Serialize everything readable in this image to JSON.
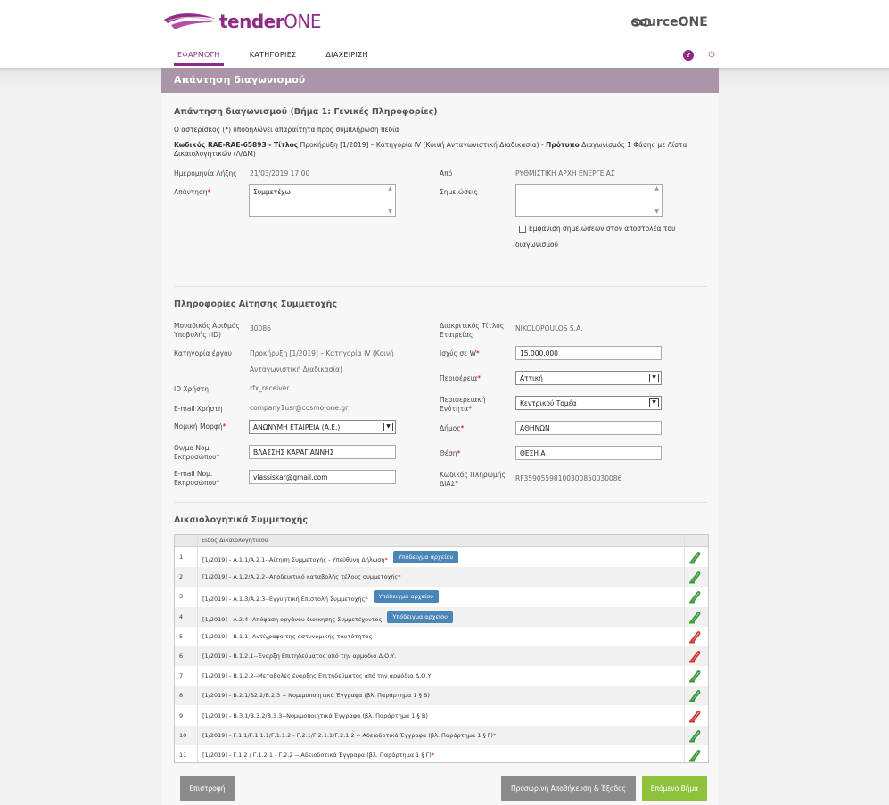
{
  "app": {
    "logo_bold": "tender",
    "logo_light": "ONE",
    "partner_logo": "sourceONE"
  },
  "nav": {
    "items": [
      "ΕΦΑΡΜΟΓΗ",
      "ΚΑΤΗΓΟΡΙΕΣ",
      "ΔΙΑΧΕΙΡΙΣΗ"
    ],
    "help_icon": "?",
    "power_icon": "⏻"
  },
  "page_title": "Απάντηση διαγωνισμού",
  "step1": {
    "title": "Απάντηση διαγωνισμού (Βήμα 1: Γενικές Πληροφορίες)",
    "required_note": "Ο αστερίσκος (*) υποδηλώνει απαραίτητα προς συμπλήρωση πεδία",
    "code_label": "Κωδικός RAE-RAE-65893 - ",
    "title_label": "Τίτλος",
    "title_value": " Προκήρυξη [1/2019] – Κατηγορία IV (Κοινή Ανταγωνιστική Διαδικασία) - ",
    "template_label": "Πρότυπο",
    "template_value_line1": " Διαγωνισμός 1 Φάσης με Λίστα",
    "template_value_line2": "Δικαιολογητικών (Λ/ΔΜ)",
    "deadline_label": "Ημερομηνία Λήξης",
    "deadline_value": "21/03/2019 17:00",
    "from_label": "Από",
    "from_value": "ΡΥΘΜΙΣΤΙΚΗ ΑΡΧΗ ΕΝΕΡΓΕΙΑΣ",
    "answer_label": "Απάντηση",
    "answer_value": "Συμμετέχω",
    "notes_label": "Σημειώσεις",
    "notes_value": "",
    "show_notes_line1": "Εμφάνιση σημειώσεων στον αποστολέα του",
    "show_notes_line2": "διαγωνισμού"
  },
  "application": {
    "title": "Πληροφορίες Αίτησης Συμμετοχής",
    "id_label": "Μοναδικός Αριθμός Υποβολής (ID)",
    "id_value": "30086",
    "category_label": "Κατηγορία έργου",
    "category_line1": "Προκήρυξη [1/2019] – Κατηγορία IV (Κοινή",
    "category_line2": "Ανταγωνιστική Διαδικασία)",
    "user_id_label": "ID Χρήστη",
    "user_id_value": "rfx_receiver",
    "email_label": "E-mail Χρήστη",
    "email_value": "company1usr@cosmo-one.gr",
    "legal_form_label": "Νομική Μορφή",
    "legal_form_value": "ΑΝΩΝΥΜΗ ΕΤΑΙΡΕΙΑ (Α.Ε.)",
    "rep_name_label": "Ον/μο Νομ. Εκπροσώπου",
    "rep_name_value": "ΒΛΑΣΣΗΣ ΚΑΡΑΓΙΑΝΝΗΣ",
    "rep_email_label": "E-mail Νομ. Εκπροσώπου",
    "rep_email_value": "vlassiskar@gmail.com",
    "trade_name_label": "Διακριτικός Τίτλος Εταιρείας",
    "trade_name_value": "NIKOLOPOULOS S.A.",
    "power_label": "Ισχύς σε W",
    "power_value": "15.000.000",
    "region_label": "Περιφέρεια",
    "region_value": "Αττική",
    "unit_label": "Περιφερειακή Ενότητα",
    "unit_value": "Κεντρικού Τομέα",
    "municipality_label": "Δήμος",
    "municipality_value": "ΑΘΗΝΩΝ",
    "position_label": "Θέση",
    "position_value": "ΘΕΣΗ Α",
    "payment_code_label": "Κωδικός Πληρωμής ΔΙΑΣ",
    "payment_code_value": "RF35905598100300850030086"
  },
  "documents": {
    "title": "Δικαιολογητικά Συμμετοχής",
    "column_header": "Είδος Δικαιολογητικού",
    "sample_label": "Υπόδειγμα αρχείου",
    "rows": [
      {
        "num": "1",
        "text": "[1/2019] - Α.1.1/Α.2.1--Αίτηση Συμμετοχής - Υπεύθυνη Δήλωση",
        "req": "*",
        "sample": true,
        "clip": "green"
      },
      {
        "num": "2",
        "text": "[1/2019] - Α.1.2/Α.2.2--Αποδεικτικό καταβολής τέλους συμμετοχής",
        "req": "*",
        "sample": false,
        "clip": "green"
      },
      {
        "num": "3",
        "text": "[1/2019] - Α.1.3/Α.2.3--Εγγυητική Επιστολή Συμμετοχής",
        "req": "*",
        "sample": true,
        "clip": "green"
      },
      {
        "num": "4",
        "text": "[1/2019] - Α.2.4--Απόφαση οργάνου διοίκησης Συμμετέχοντος",
        "req": "",
        "sample": true,
        "clip": "green"
      },
      {
        "num": "5",
        "text": "[1/2019] - Β.1.1--Αντίγραφο της αστυνομικής ταυτότητας",
        "req": "",
        "sample": false,
        "clip": "red"
      },
      {
        "num": "6",
        "text": "[1/2019] - Β.1.2.1--Έναρξη Επιτηδεύματος από την αρμόδια Δ.Ο.Υ.",
        "req": "",
        "sample": false,
        "clip": "red"
      },
      {
        "num": "7",
        "text": "[1/2019] - Β.1.2.2--Μεταβολές έναρξης Επιτηδεύματος από την αρμόδια Δ.Ο.Υ.",
        "req": "",
        "sample": false,
        "clip": "green"
      },
      {
        "num": "8",
        "text": "[1/2019] - Β.2.1/Β2.2/Β.2.3 -- Νομιμοποιητικά Έγγραφα (βλ. Παράρτημα 1 § Β)",
        "req": "",
        "sample": false,
        "clip": "green"
      },
      {
        "num": "9",
        "text": "[1/2019] - Β.3.1/Β.3.2/Β.3.3--Νομιμοποιητικά Έγγραφα (βλ. Παράρτημα 1 § Β)",
        "req": "",
        "sample": false,
        "clip": "red"
      },
      {
        "num": "10",
        "text": "[1/2019] - Γ.1.1/Γ.1.1.1/Γ.1.1.2 - Γ.2.1/Γ.2.1.1/Γ.2.1.2 -- Αδειοδοτικά Έγγραφα (βλ. Παράρτημα 1 § Γ)",
        "req": "*",
        "sample": false,
        "clip": "green"
      },
      {
        "num": "11",
        "text": "[1/2019] - Γ.1.2 / Γ.1.2.1 - Γ.2.2 -- Αδειοδοτικά Έγγραφα (βλ. Παράρτημα 1 § Γ)",
        "req": "*",
        "sample": false,
        "clip": "green"
      }
    ]
  },
  "buttons": {
    "back": "Επιστροφή",
    "save_exit": "Προσωρινή Αποθήκευση & Έξοδος",
    "next": "Επόμενο Βήμα"
  },
  "colors": {
    "brand": "#8e2c85",
    "header_bar": "#ab96a9",
    "sample_button": "#4a86b8",
    "next_button": "#8fc23c",
    "clip_ok": "#3d9a3d",
    "clip_missing": "#d03a3a"
  }
}
